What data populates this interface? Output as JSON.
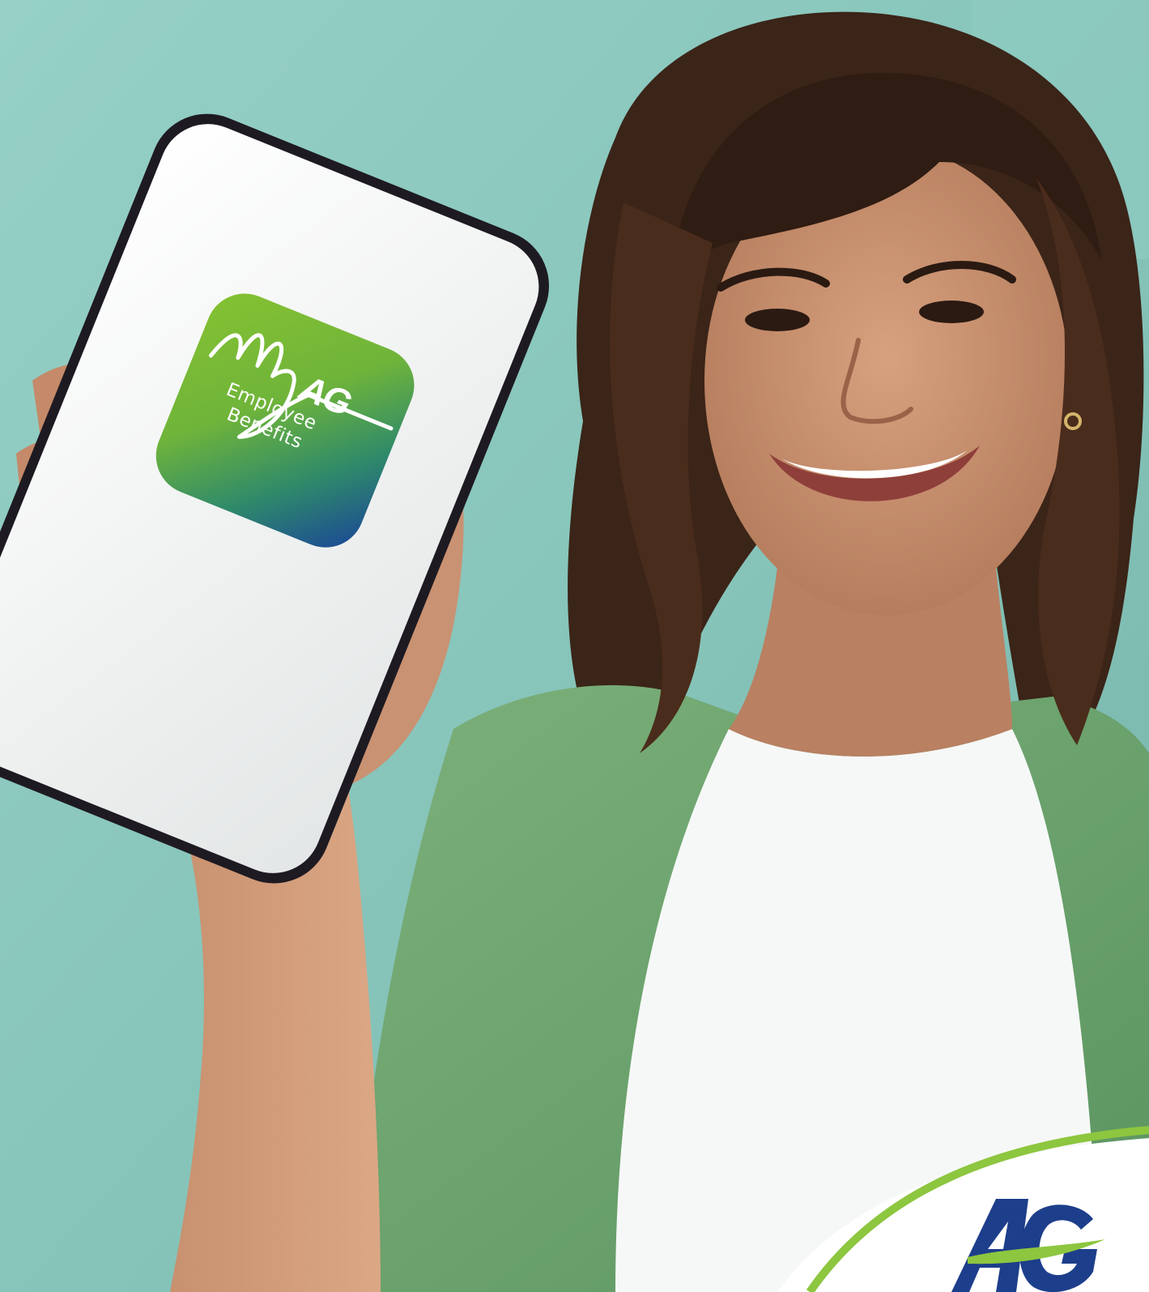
{
  "app_icon": {
    "wordmark_my": "My",
    "wordmark_brand": "AG",
    "subtitle_line1": "Employee",
    "subtitle_line2": "Benefits"
  },
  "corner_logo": {
    "brand": "AG"
  },
  "colors": {
    "background_teal": "#8cc6bd",
    "icon_green": "#7dbb2b",
    "icon_blue": "#1f4e93",
    "jacket_green": "#6ea36c",
    "brand_navy": "#1d3e8a",
    "brand_lime": "#8dc63f"
  }
}
